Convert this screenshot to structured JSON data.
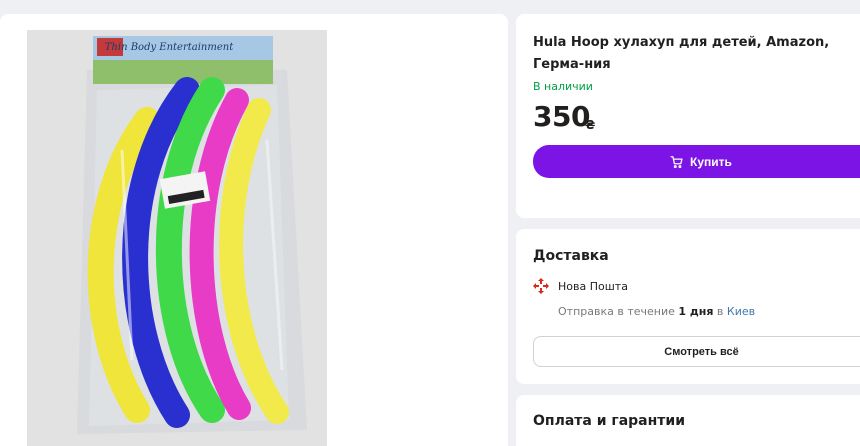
{
  "gallery": {
    "package_label": "Thin Body Entertainment",
    "image_subject": "hula-hoop-package"
  },
  "product": {
    "title": "Hula Hoop хулахуп для детей, Amazon, Герма-ния",
    "availability": "В наличии",
    "price": "350",
    "currency": "₴",
    "buy_label": "Купить",
    "accent_color": "#7b14e4",
    "stock_color": "#00a046"
  },
  "delivery": {
    "heading": "Доставка",
    "carrier": "Нова Пошта",
    "dispatch_prefix": "Отправка в течение",
    "dispatch_time": "1 дня",
    "dispatch_in": "в",
    "dispatch_city": "Киев",
    "see_all_label": "Смотреть всё"
  },
  "payment": {
    "heading": "Оплата и гарантии"
  }
}
